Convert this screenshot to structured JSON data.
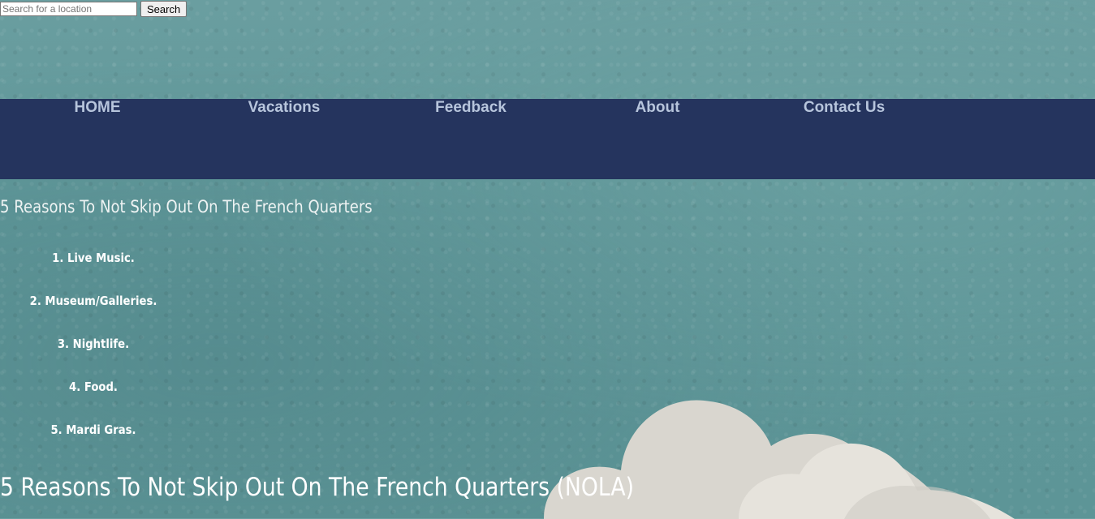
{
  "search": {
    "placeholder": "Search for a location",
    "button_label": "Search"
  },
  "nav": {
    "items": [
      {
        "label": "HOME"
      },
      {
        "label": "Vacations"
      },
      {
        "label": "Feedback"
      },
      {
        "label": "About"
      },
      {
        "label": "Contact Us"
      }
    ]
  },
  "article": {
    "subtitle": "5 Reasons To Not Skip Out On The French Quarters",
    "reasons": [
      "1. Live Music.",
      "2. Museum/Galleries.",
      "3. Nightlife.",
      "4. Food.",
      "5. Mardi Gras."
    ],
    "title": "5 Reasons To Not Skip Out On The French Quarters (NOLA)"
  },
  "colors": {
    "nav_bg": "#25345e",
    "nav_text": "#b7c5dc",
    "page_bg": "#5f9799"
  }
}
